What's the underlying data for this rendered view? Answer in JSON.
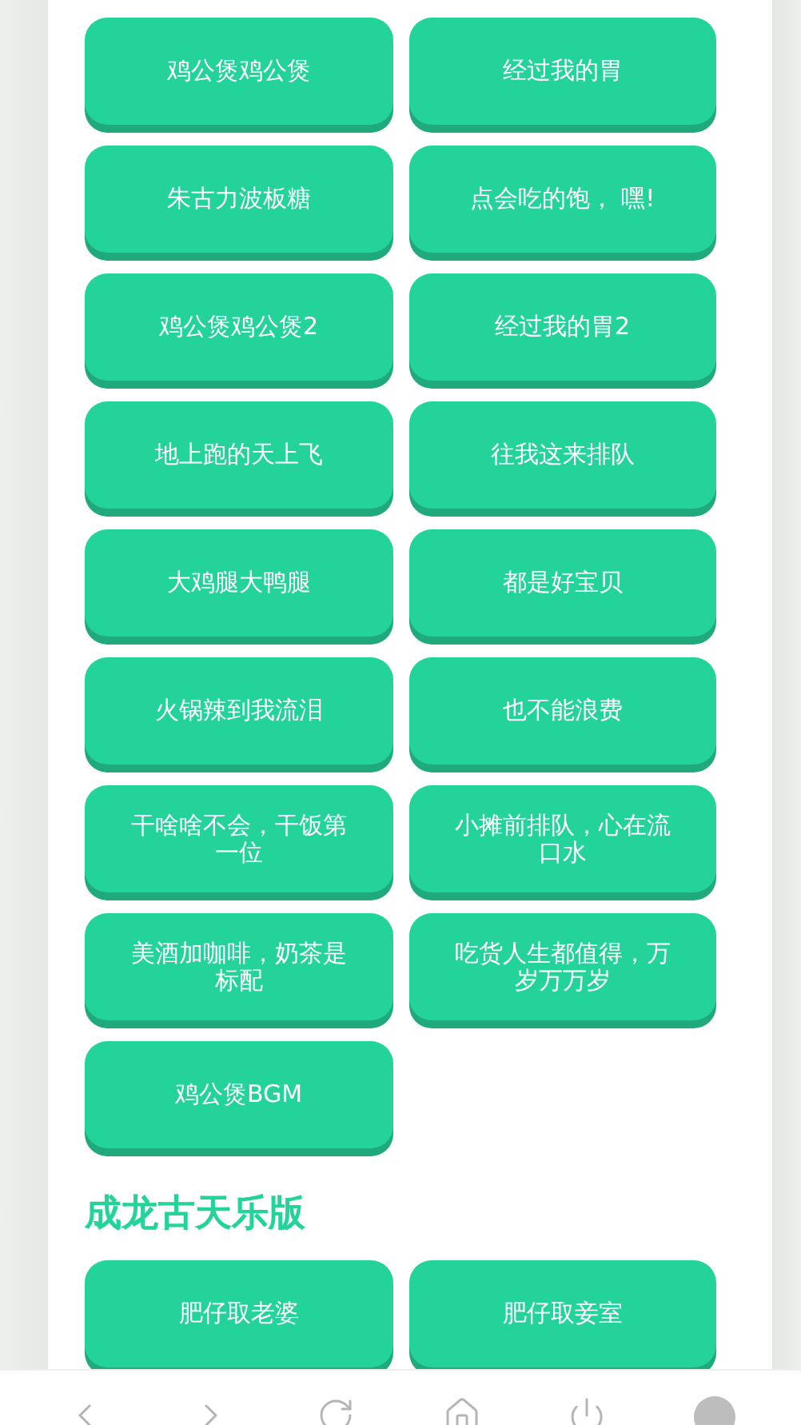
{
  "sections": [
    {
      "buttons": [
        "鸡公煲鸡公煲",
        "经过我的胃",
        "朱古力波板糖",
        "点会吃的饱， 嘿!",
        "鸡公煲鸡公煲2",
        "经过我的胃2",
        "地上跑的天上飞",
        "往我这来排队",
        "大鸡腿大鸭腿",
        "都是好宝贝",
        "火锅辣到我流泪",
        "也不能浪费",
        "干啥啥不会，干饭第一位",
        "小摊前排队，心在流口水",
        "美酒加咖啡，奶茶是标配",
        "吃货人生都值得，万岁万万岁",
        "鸡公煲BGM"
      ]
    },
    {
      "title": "成龙古天乐版",
      "buttons": [
        "肥仔取老婆",
        "肥仔取妾室"
      ]
    }
  ],
  "nav": [
    {
      "kind": "back"
    },
    {
      "kind": "forward"
    },
    {
      "kind": "reload"
    },
    {
      "kind": "home"
    },
    {
      "kind": "power"
    },
    {
      "kind": "avatar"
    }
  ]
}
